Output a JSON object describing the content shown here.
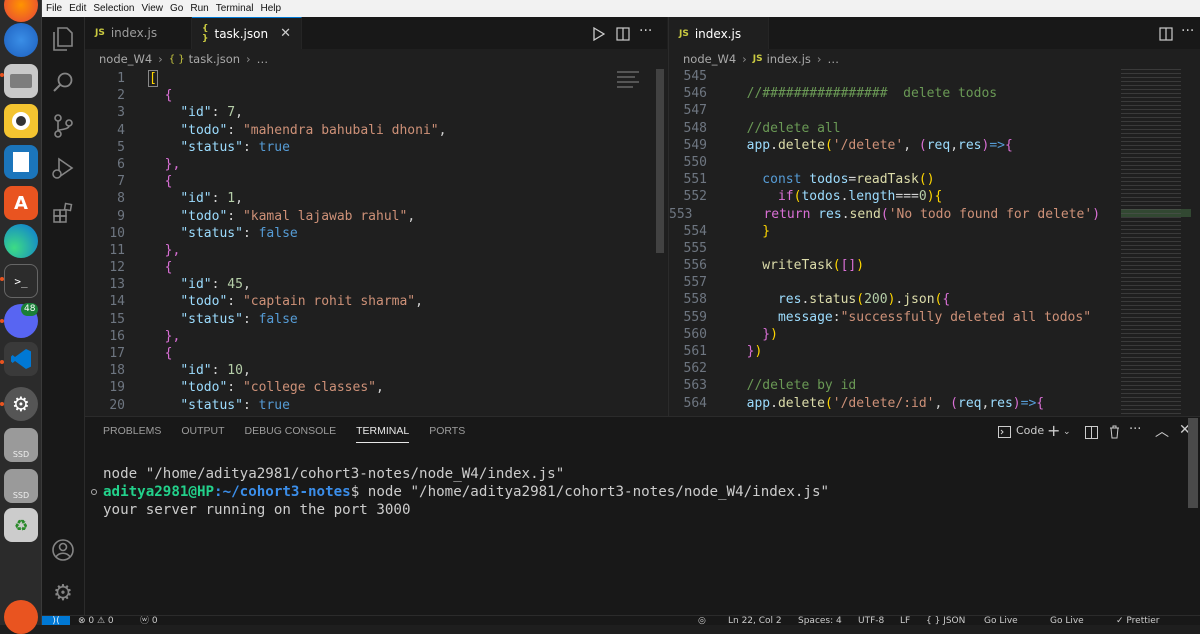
{
  "menubar": [
    "File",
    "Edit",
    "Selection",
    "View",
    "Go",
    "Run",
    "Terminal",
    "Help"
  ],
  "dock": {
    "discord_badge": "48",
    "ssd1": "SSD",
    "ssd2": "SSD"
  },
  "left_editor": {
    "tabs": [
      {
        "lang": "JS",
        "label": "index.js"
      },
      {
        "lang": "{ }",
        "label": "task.json",
        "close": "✕"
      }
    ],
    "breadcrumb": {
      "folder": "node_W4",
      "file_icon": "{ }",
      "file": "task.json",
      "more": "…"
    },
    "lines": [
      {
        "n": "1",
        "t": "["
      },
      {
        "n": "2",
        "t": "  {"
      },
      {
        "n": "3",
        "k": "\"id\"",
        "v": "7",
        "vt": "n",
        "end": ","
      },
      {
        "n": "4",
        "k": "\"todo\"",
        "v": "\"mahendra bahubali dhoni\"",
        "vt": "s",
        "end": ","
      },
      {
        "n": "5",
        "k": "\"status\"",
        "v": "true",
        "vt": "b",
        "end": ""
      },
      {
        "n": "6",
        "t": "  },"
      },
      {
        "n": "7",
        "t": "  {"
      },
      {
        "n": "8",
        "k": "\"id\"",
        "v": "1",
        "vt": "n",
        "end": ","
      },
      {
        "n": "9",
        "k": "\"todo\"",
        "v": "\"kamal lajawab rahul\"",
        "vt": "s",
        "end": ","
      },
      {
        "n": "10",
        "k": "\"status\"",
        "v": "false",
        "vt": "b",
        "end": ""
      },
      {
        "n": "11",
        "t": "  },"
      },
      {
        "n": "12",
        "t": "  {"
      },
      {
        "n": "13",
        "k": "\"id\"",
        "v": "45",
        "vt": "n",
        "end": ","
      },
      {
        "n": "14",
        "k": "\"todo\"",
        "v": "\"captain rohit sharma\"",
        "vt": "s",
        "end": ","
      },
      {
        "n": "15",
        "k": "\"status\"",
        "v": "false",
        "vt": "b",
        "end": ""
      },
      {
        "n": "16",
        "t": "  },"
      },
      {
        "n": "17",
        "t": "  {"
      },
      {
        "n": "18",
        "k": "\"id\"",
        "v": "10",
        "vt": "n",
        "end": ","
      },
      {
        "n": "19",
        "k": "\"todo\"",
        "v": "\"college classes\"",
        "vt": "s",
        "end": ","
      },
      {
        "n": "20",
        "k": "\"status\"",
        "v": "true",
        "vt": "b",
        "end": ""
      }
    ]
  },
  "right_editor": {
    "tabs": [
      {
        "lang": "JS",
        "label": "index.js"
      }
    ],
    "breadcrumb": {
      "folder": "node_W4",
      "file_icon": "JS",
      "file": "index.js",
      "more": "…"
    },
    "lines": [
      {
        "n": "545",
        "parts": []
      },
      {
        "n": "546",
        "parts": [
          [
            "c",
            "  //################  delete todos"
          ]
        ]
      },
      {
        "n": "547",
        "parts": []
      },
      {
        "n": "548",
        "parts": [
          [
            "c",
            "  //delete all"
          ]
        ]
      },
      {
        "n": "549",
        "parts": [
          [
            "v",
            "  app"
          ],
          [
            "w",
            "."
          ],
          [
            "f",
            "delete"
          ],
          [
            "y",
            "("
          ],
          [
            "s",
            "'/delete'"
          ],
          [
            "w",
            ", "
          ],
          [
            "p",
            "("
          ],
          [
            "v",
            "req"
          ],
          [
            "w",
            ","
          ],
          [
            "v",
            "res"
          ],
          [
            "p",
            ")"
          ],
          [
            "pl",
            "=>"
          ],
          [
            "p",
            "{"
          ]
        ]
      },
      {
        "n": "550",
        "parts": []
      },
      {
        "n": "551",
        "parts": [
          [
            "pl",
            "    const "
          ],
          [
            "v",
            "todos"
          ],
          [
            "w",
            "="
          ],
          [
            "f",
            "readTask"
          ],
          [
            "y",
            "()"
          ]
        ]
      },
      {
        "n": "552",
        "parts": [
          [
            "p",
            "      if"
          ],
          [
            "y",
            "("
          ],
          [
            "v",
            "todos"
          ],
          [
            "w",
            "."
          ],
          [
            "v",
            "length"
          ],
          [
            "w",
            "==="
          ],
          [
            "n",
            "0"
          ],
          [
            "y",
            "){"
          ]
        ]
      },
      {
        "n": "553",
        "parts": [
          [
            "p",
            "      return "
          ],
          [
            "v",
            "res"
          ],
          [
            "w",
            "."
          ],
          [
            "f",
            "send"
          ],
          [
            "p",
            "("
          ],
          [
            "s",
            "'No todo found for delete'"
          ],
          [
            "p",
            ")"
          ]
        ]
      },
      {
        "n": "554",
        "parts": [
          [
            "y",
            "    }"
          ]
        ]
      },
      {
        "n": "555",
        "parts": []
      },
      {
        "n": "556",
        "parts": [
          [
            "f",
            "    writeTask"
          ],
          [
            "y",
            "("
          ],
          [
            "p",
            "[]"
          ],
          [
            "y",
            ")"
          ]
        ]
      },
      {
        "n": "557",
        "parts": []
      },
      {
        "n": "558",
        "parts": [
          [
            "v",
            "      res"
          ],
          [
            "w",
            "."
          ],
          [
            "f",
            "status"
          ],
          [
            "y",
            "("
          ],
          [
            "n",
            "200"
          ],
          [
            "y",
            ")"
          ],
          [
            "w",
            "."
          ],
          [
            "f",
            "json"
          ],
          [
            "y",
            "("
          ],
          [
            "p",
            "{"
          ]
        ]
      },
      {
        "n": "559",
        "parts": [
          [
            "v",
            "      message"
          ],
          [
            "w",
            ":"
          ],
          [
            "s",
            "\"successfully deleted all todos\""
          ]
        ]
      },
      {
        "n": "560",
        "parts": [
          [
            "p",
            "    }"
          ],
          [
            "y",
            ")"
          ]
        ]
      },
      {
        "n": "561",
        "parts": [
          [
            "p",
            "  }"
          ],
          [
            "y",
            ")"
          ]
        ]
      },
      {
        "n": "562",
        "parts": []
      },
      {
        "n": "563",
        "parts": [
          [
            "c",
            "  //delete by id"
          ]
        ]
      },
      {
        "n": "564",
        "parts": [
          [
            "v",
            "  app"
          ],
          [
            "w",
            "."
          ],
          [
            "f",
            "delete"
          ],
          [
            "y",
            "("
          ],
          [
            "s",
            "'/delete/:id'"
          ],
          [
            "w",
            ", "
          ],
          [
            "p",
            "("
          ],
          [
            "v",
            "req"
          ],
          [
            "w",
            ","
          ],
          [
            "v",
            "res"
          ],
          [
            "p",
            ")"
          ],
          [
            "pl",
            "=>"
          ],
          [
            "p",
            "{"
          ]
        ]
      }
    ]
  },
  "panel": {
    "tabs": [
      "PROBLEMS",
      "OUTPUT",
      "DEBUG CONSOLE",
      "TERMINAL",
      "PORTS"
    ],
    "active_tab": "TERMINAL",
    "terminal_profile": "Code",
    "terminal": {
      "line1": "node \"/home/aditya2981/cohort3-notes/node_W4/index.js\"",
      "prompt_user": "aditya2981@HP",
      "prompt_path": ":~/cohort3-notes",
      "prompt_cmd": "$ node \"/home/aditya2981/cohort3-notes/node_W4/index.js\"",
      "line3": "your server running on the port 3000"
    }
  },
  "statusbar": {
    "errors": "⊗ 0 ⚠ 0",
    "ports": "ⓦ 0",
    "position": "Ln 22, Col 2",
    "spaces": "Spaces: 4",
    "encoding": "UTF-8",
    "eol": "LF",
    "language": "{ } JSON",
    "golive1": "Go Live",
    "golive2": "Go Live",
    "prettier": "✓ Prettier"
  },
  "colors": {
    "accent": "#0078d4",
    "terminal_user": "#23d18b",
    "terminal_path": "#3b8eea"
  }
}
